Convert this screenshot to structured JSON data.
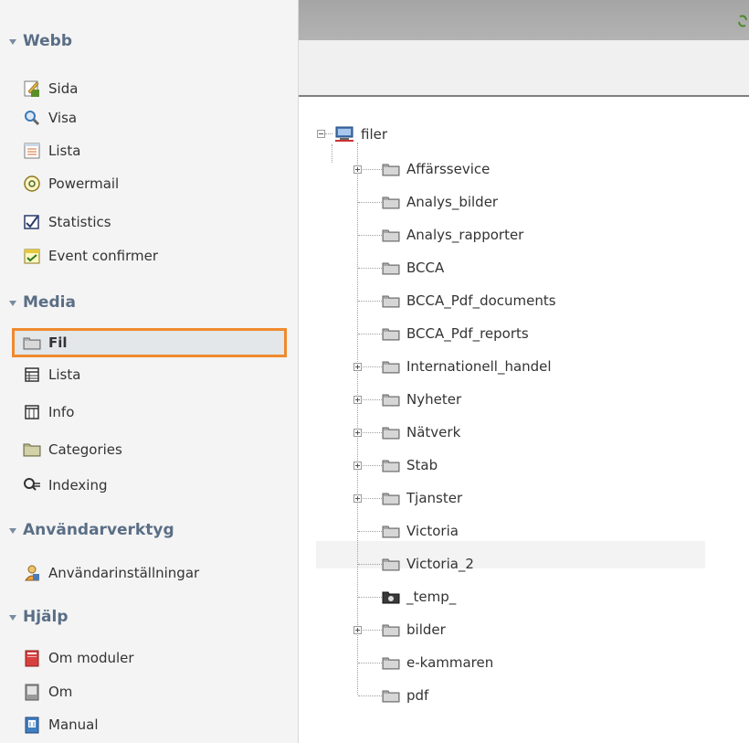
{
  "sidebar": {
    "sections": [
      {
        "title": "Webb",
        "items": [
          "Sida",
          "Visa",
          "Lista",
          "Powermail",
          "Statistics",
          "Event confirmer"
        ]
      },
      {
        "title": "Media",
        "items": [
          "Fil",
          "Lista",
          "Info",
          "Categories",
          "Indexing"
        ]
      },
      {
        "title": "Användarverktyg",
        "items": [
          "Användarinställningar"
        ]
      },
      {
        "title": "Hjälp",
        "items": [
          "Om moduler",
          "Om",
          "Manual"
        ]
      }
    ],
    "active_item": "Fil"
  },
  "tree": {
    "root": "filer",
    "folders": [
      "Affärssevice",
      "Analys_bilder",
      "Analys_rapporter",
      "BCCA",
      "BCCA_Pdf_documents",
      "BCCA_Pdf_reports",
      "Internationell_handel",
      "Nyheter",
      "Nätverk",
      "Stab",
      "Tjanster",
      "Victoria",
      "Victoria_2",
      "_temp_",
      "bilder",
      "e-kammaren",
      "pdf"
    ]
  },
  "colors": {
    "active_border": "#f0892d",
    "section_header": "#5a6e86"
  }
}
